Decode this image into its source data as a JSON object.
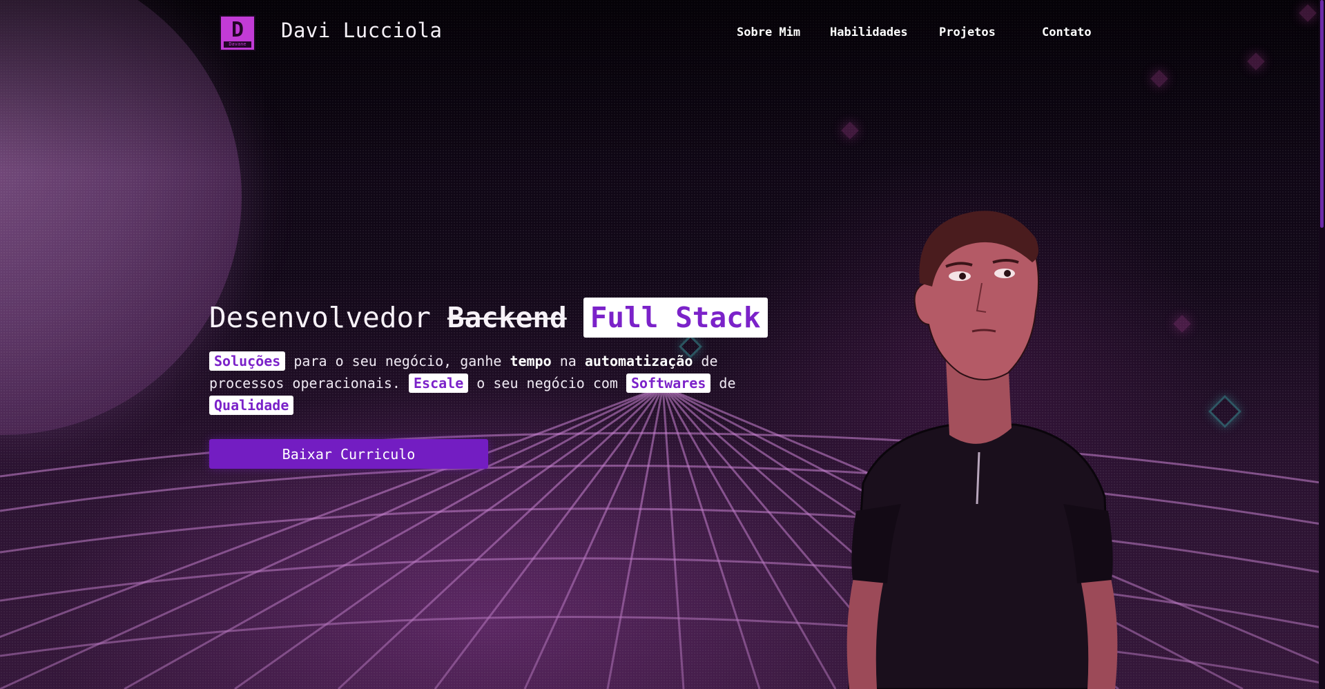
{
  "header": {
    "logo_letter": "D",
    "logo_sub": "Davane",
    "brand_name": "Davi Lucciola",
    "nav": [
      {
        "label": "Sobre Mim"
      },
      {
        "label": "Habilidades"
      },
      {
        "label": "Projetos"
      },
      {
        "label": "Contato"
      }
    ]
  },
  "hero": {
    "title_word": "Desenvolvedor",
    "title_struck": "Backend",
    "title_highlight": "Full Stack",
    "text": {
      "chip_solucoes": "Soluções",
      "seg1": " para o seu negócio, ganhe ",
      "bold_tempo": "tempo",
      "seg2": " na ",
      "bold_auto": "automatização",
      "seg3": " de processos operacionais. ",
      "chip_escale": "Escale",
      "seg4": " o seu negócio com ",
      "chip_softwares": "Softwares",
      "seg5": " de ",
      "chip_qualidade": "Qualidade"
    },
    "cta_label": "Baixar Curriculo"
  },
  "colors": {
    "accent": "#7b22c9",
    "button": "#731dc2",
    "logo": "#c23bd6",
    "background": "#07030b"
  },
  "icons": {
    "logo": "davane-logo-icon"
  }
}
